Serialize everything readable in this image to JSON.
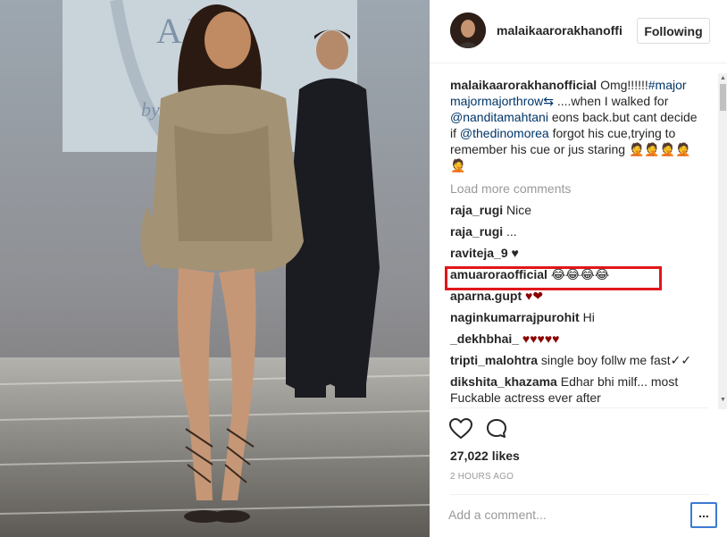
{
  "post": {
    "photo_icon": "runway-photo",
    "photo_sign_text": "A  YA",
    "photo_sign_sub": "by"
  },
  "header": {
    "username": "malaikaarorakhanofficial",
    "follow_label": "Following"
  },
  "caption": {
    "username": "malaikaarorakhanofficial",
    "text_1": " Omg!!!!!!",
    "tags": "#major majormajorthrow",
    "emoji_1": "⇆",
    "text_2": " ....when I walked for ",
    "mention_1": "@nanditamahtani",
    "text_3": " eons back.but cant decide if ",
    "mention_2": "@thedinomorea",
    "text_4": " forgot his cue,trying to remember his cue or jus staring ",
    "text_end": "🤦🤦🤦🤦🤦"
  },
  "load_more": "Load more comments",
  "comments": [
    {
      "user": "raja_rugi",
      "text": "Nice"
    },
    {
      "user": "raja_rugi",
      "text": "..."
    },
    {
      "user": "raviteja_9",
      "text": "♥"
    },
    {
      "user": "amuaroraofficial",
      "text": "😂😂😂😂"
    },
    {
      "user": "aparna.gupt",
      "text": "♥❤"
    },
    {
      "user": "naginkumarrajpurohit",
      "text": "Hi"
    },
    {
      "user": "_dekhbhai_",
      "text": "♥♥♥♥♥"
    },
    {
      "user": "tripti_malohtra",
      "text": "single boy follw me fast✓✓"
    },
    {
      "user": "dikshita_khazama",
      "text": "Edhar bhi milf... most Fuckable actress ever after"
    }
  ],
  "likes": "27,022 likes",
  "time": "2 HOURS AGO",
  "add_comment_placeholder": "Add a comment...",
  "more_label": "...",
  "colors": {
    "highlight": "#e0161b",
    "link": "#003569",
    "heart": "#8b0000",
    "focus": "#3c7bd2"
  },
  "icons": {
    "like": "heart-outline-icon",
    "comment": "speech-bubble-icon",
    "scroll_up": "scroll-up-arrow",
    "scroll_down": "scroll-down-arrow"
  }
}
